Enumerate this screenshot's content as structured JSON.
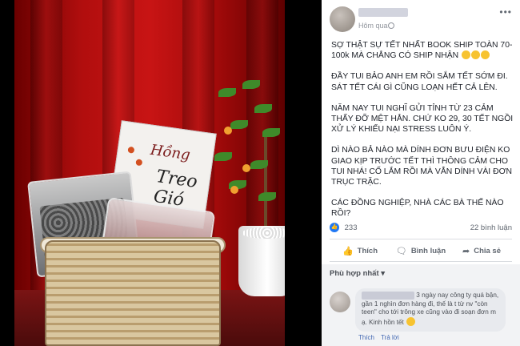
{
  "post": {
    "time": "Hôm qua",
    "paragraphs": [
      "SỢ THẬT SỰ TẾT NHẤT BOOK SHIP TOÀN 70-100k MÀ CHẲNG CÓ SHIP NHẬN",
      "ĐẦY TUI BẢO ANH EM RỒI SẮM TẾT SỚM ĐI. SÁT TẾT CÁI GÌ CŨNG LOẠN HẾT CẢ LÊN.",
      "NĂM NAY TUI NGHĨ GỬI TỈNH TỪ 23 CẢM THẤY ĐỠ MỆT HẲN. CHỨ KO 29, 30 TẾT NGỒI XỬ LÝ KHIẾU NẠI STRESS LUÔN Ý.",
      "DÌ NÀO BẢ NÀO MÀ DÍNH ĐƠN BƯU ĐIỆN KO GIAO KỊP TRƯỚC TẾT THÌ THÔNG CẢM CHO TUI NHÁ! CỐ LẮM RỒI MÀ VẪN DÍNH VÀI ĐƠN TRỤC TRẶC.",
      "CÁC ĐỒNG NGHIỆP, NHÀ CÁC BÀ THẾ NÀO RỒI?"
    ],
    "likes": "233",
    "comments_count": "22 bình luận"
  },
  "actions": {
    "like": "Thích",
    "comment": "Bình luận",
    "share": "Chia sẻ"
  },
  "comments": {
    "sort_label": "Phù hợp nhất",
    "first": {
      "text": "3 ngày nay công ty quá bận, gần 1 nghìn đơn hàng đi, thế là t từ nv \"còn teen\" cho tới trông xe cũng vào đi soạn đơn m ạ. Kinh hồn tết",
      "like_label": "Thích",
      "reply_label": "Trả lời"
    }
  },
  "photo": {
    "bag_text_1": "Hồng",
    "bag_text_2": "Treo Gió"
  },
  "icons": {
    "more": "more-dots-icon",
    "globe": "globe-icon",
    "like": "thumbs-up-icon",
    "comment": "speech-bubble-icon",
    "share": "share-arrow-icon"
  }
}
